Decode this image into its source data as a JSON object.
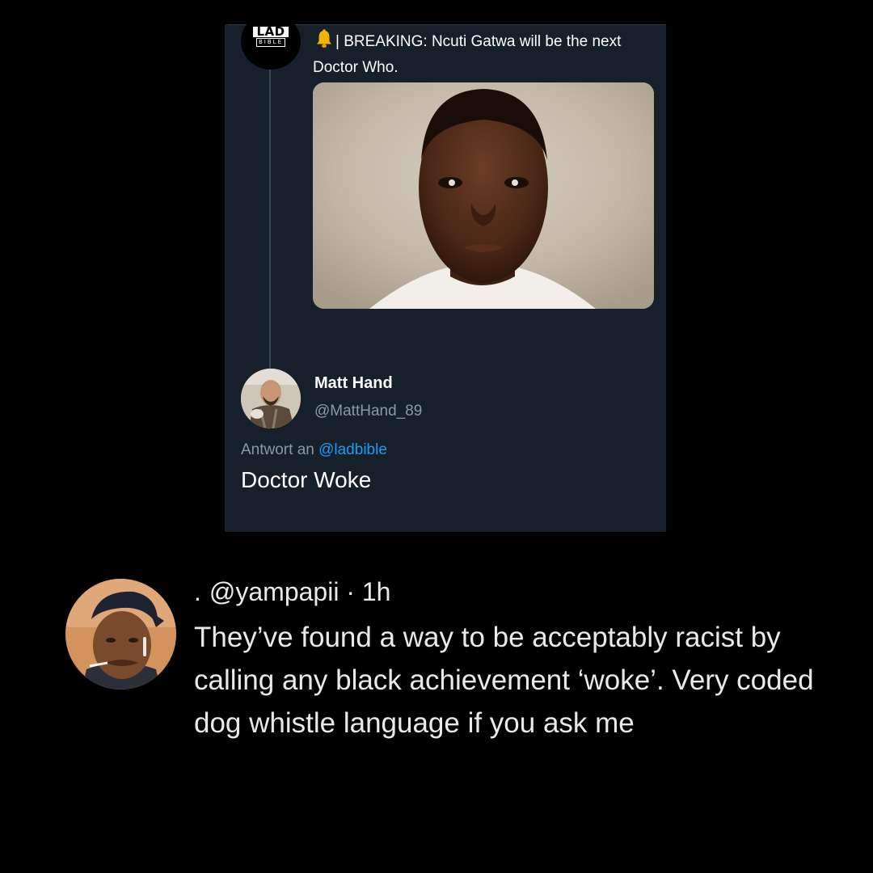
{
  "embed": {
    "logo_top": "LAD",
    "logo_bottom": "BIBLE",
    "headline": "| BREAKING: Ncuti Gatwa will be the next Doctor Who.",
    "bell_icon": "bell-icon",
    "image_alt": "portrait photo",
    "reply": {
      "name": "Matt Hand",
      "handle": "@MattHand_89",
      "reply_prefix": "Antwort an",
      "reply_mention": "@ladbible",
      "text": "Doctor Woke"
    },
    "colors": {
      "background": "#15202b",
      "link": "#1d9bf0",
      "muted": "#8b98a5"
    }
  },
  "tweet": {
    "dot": ".",
    "handle": "@yampapii",
    "time": "· 1h",
    "body": "They’ve found a way to be acceptably racist by calling any black achievement ‘woke’. Very coded dog whistle language if you ask me"
  }
}
